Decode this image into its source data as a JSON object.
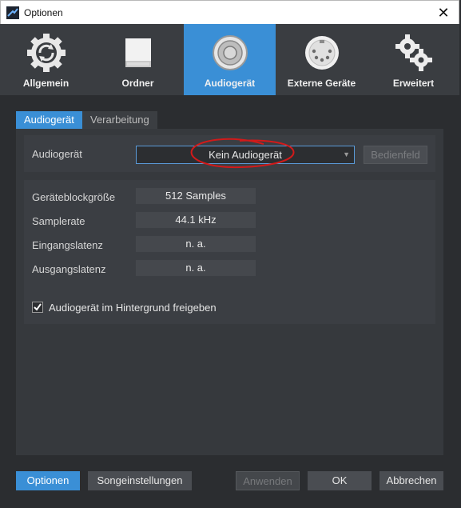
{
  "window": {
    "title": "Optionen"
  },
  "categories": [
    {
      "label": "Allgemein",
      "icon": "refresh-gear-icon"
    },
    {
      "label": "Ordner",
      "icon": "drive-icon"
    },
    {
      "label": "Audiogerät",
      "icon": "speaker-icon"
    },
    {
      "label": "Externe Geräte",
      "icon": "midi-connector-icon"
    },
    {
      "label": "Erweitert",
      "icon": "gears-icon"
    }
  ],
  "active_category": "Audiogerät",
  "subtabs": [
    {
      "label": "Audiogerät"
    },
    {
      "label": "Verarbeitung"
    }
  ],
  "device": {
    "label": "Audiogerät",
    "selected": "Kein Audiogerät",
    "control_button": "Bedienfeld"
  },
  "settings": [
    {
      "label": "Geräteblockgröße",
      "value": "512 Samples"
    },
    {
      "label": "Samplerate",
      "value": "44.1 kHz"
    },
    {
      "label": "Eingangslatenz",
      "value": "n. a."
    },
    {
      "label": "Ausgangslatenz",
      "value": "n. a."
    }
  ],
  "background_release": {
    "label": "Audiogerät im Hintergrund freigeben",
    "checked": true
  },
  "footer": {
    "options": "Optionen",
    "song_settings": "Songeinstellungen",
    "apply": "Anwenden",
    "ok": "OK",
    "cancel": "Abbrechen"
  },
  "colors": {
    "accent": "#3a8fd6",
    "annotation": "#d11a1a"
  }
}
